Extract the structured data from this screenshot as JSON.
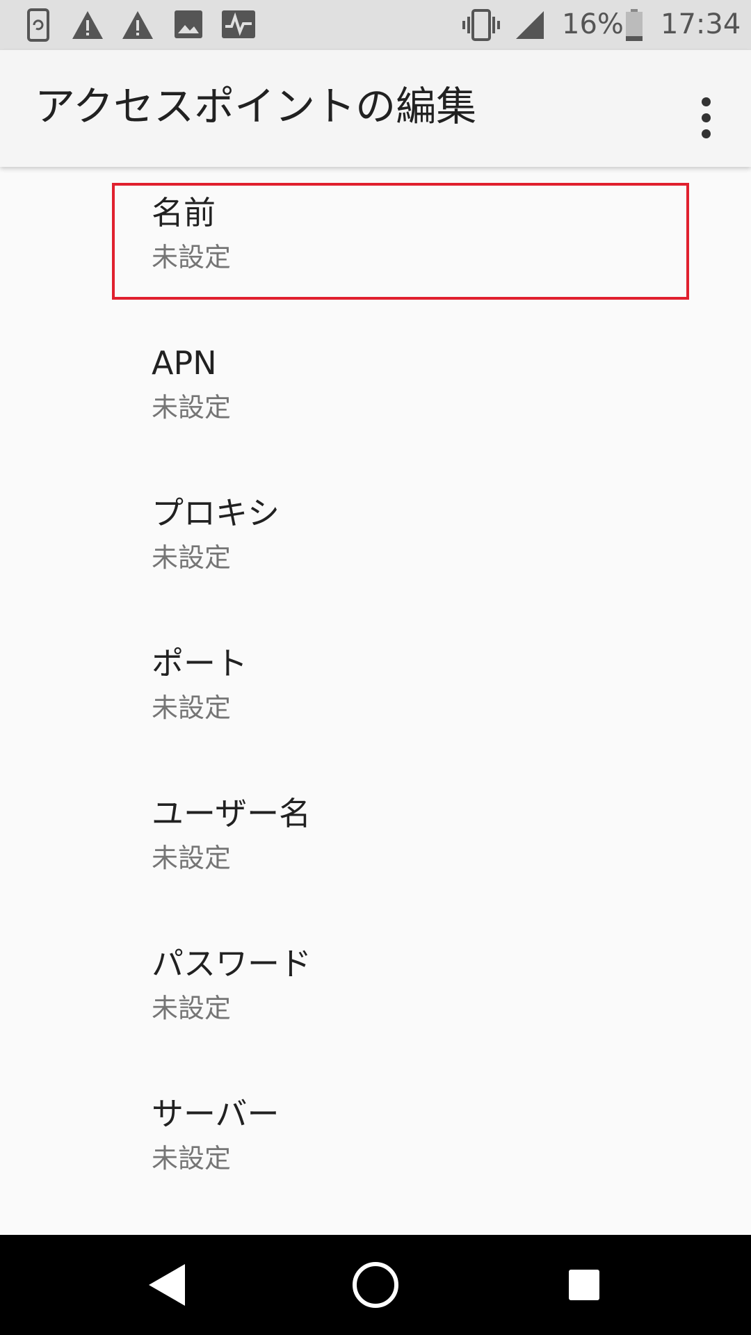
{
  "status_bar": {
    "battery_percent": "16%",
    "time": "17:34",
    "icons": [
      "screen-rotation-icon",
      "warning-icon",
      "warning-icon",
      "image-icon",
      "activity-icon",
      "vibrate-icon",
      "signal-icon",
      "battery-icon"
    ]
  },
  "app_bar": {
    "title": "アクセスポイントの編集",
    "overflow_icon": "more-vert-icon"
  },
  "items": [
    {
      "title": "名前",
      "summary": "未設定"
    },
    {
      "title": "APN",
      "summary": "未設定"
    },
    {
      "title": "プロキシ",
      "summary": "未設定"
    },
    {
      "title": "ポート",
      "summary": "未設定"
    },
    {
      "title": "ユーザー名",
      "summary": "未設定"
    },
    {
      "title": "パスワード",
      "summary": "未設定"
    },
    {
      "title": "サーバー",
      "summary": "未設定"
    }
  ],
  "highlight_color": "#e0202e",
  "nav_bar": {
    "icons": [
      "back-icon",
      "home-icon",
      "recents-icon"
    ]
  }
}
